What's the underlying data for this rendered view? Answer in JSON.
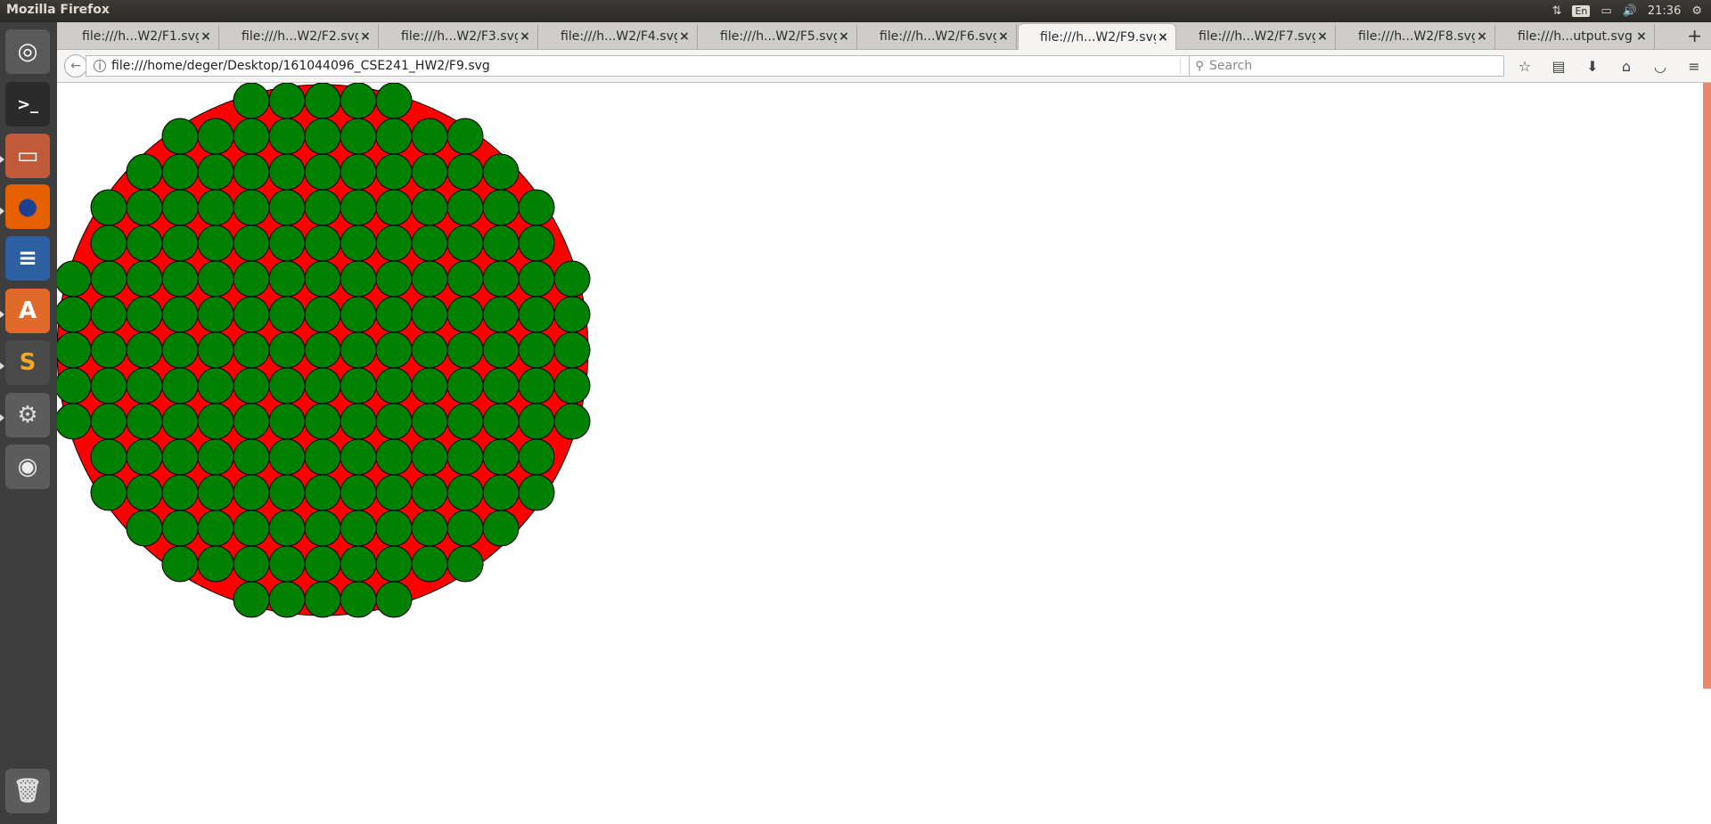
{
  "window": {
    "title": "Mozilla Firefox"
  },
  "tray": {
    "lang": "En",
    "clock": "21:36"
  },
  "launcher": {
    "items": [
      {
        "name": "ubuntu-dash-icon",
        "glyph": "◎",
        "bg": "#5a5a5a",
        "fg": "#ffffff"
      },
      {
        "name": "terminal-icon",
        "glyph": ">_",
        "bg": "#2b2b2b",
        "fg": "#ffffff"
      },
      {
        "name": "files-icon",
        "glyph": "▭",
        "bg": "#c15a3a",
        "fg": "#ffffff"
      },
      {
        "name": "firefox-icon",
        "glyph": "●",
        "bg": "#e66000",
        "fg": "#1f3f8f"
      },
      {
        "name": "libreoffice-writer-icon",
        "glyph": "≡",
        "bg": "#2d5fa3",
        "fg": "#ffffff"
      },
      {
        "name": "software-center-icon",
        "glyph": "A",
        "bg": "#e06a2c",
        "fg": "#ffffff"
      },
      {
        "name": "sublime-text-icon",
        "glyph": "S",
        "bg": "#4a4a4a",
        "fg": "#f5a623"
      },
      {
        "name": "system-settings-icon",
        "glyph": "⚙",
        "bg": "#5c5c5c",
        "fg": "#dddddd"
      },
      {
        "name": "disc-icon",
        "glyph": "◉",
        "bg": "#5c5c5c",
        "fg": "#eeeeee"
      },
      {
        "name": "trash-icon",
        "glyph": "🗑",
        "bg": "#5c5c5c",
        "fg": "#dddddd"
      }
    ]
  },
  "tabs": [
    {
      "label": "file:///h...W2/F1.svg"
    },
    {
      "label": "file:///h...W2/F2.svg"
    },
    {
      "label": "file:///h...W2/F3.svg"
    },
    {
      "label": "file:///h...W2/F4.svg"
    },
    {
      "label": "file:///h...W2/F5.svg"
    },
    {
      "label": "file:///h...W2/F6.svg"
    },
    {
      "label": "file:///h...W2/F9.svg",
      "active": true
    },
    {
      "label": "file:///h...W2/F7.svg"
    },
    {
      "label": "file:///h...W2/F8.svg"
    },
    {
      "label": "file:///h...utput.svg"
    }
  ],
  "tab_close_glyph": "×",
  "navbar": {
    "url": "file:///home/deger/Desktop/161044096_CSE241_HW2/F9.svg",
    "search_placeholder": "Search"
  },
  "svg_content": {
    "big_circle_fill": "#ff0000",
    "small_circle_fill": "#008000",
    "stroke": "#000000",
    "row_circle_counts": [
      5,
      9,
      11,
      13,
      13,
      15,
      15,
      15,
      15,
      15,
      13,
      13,
      11,
      9,
      5
    ]
  }
}
